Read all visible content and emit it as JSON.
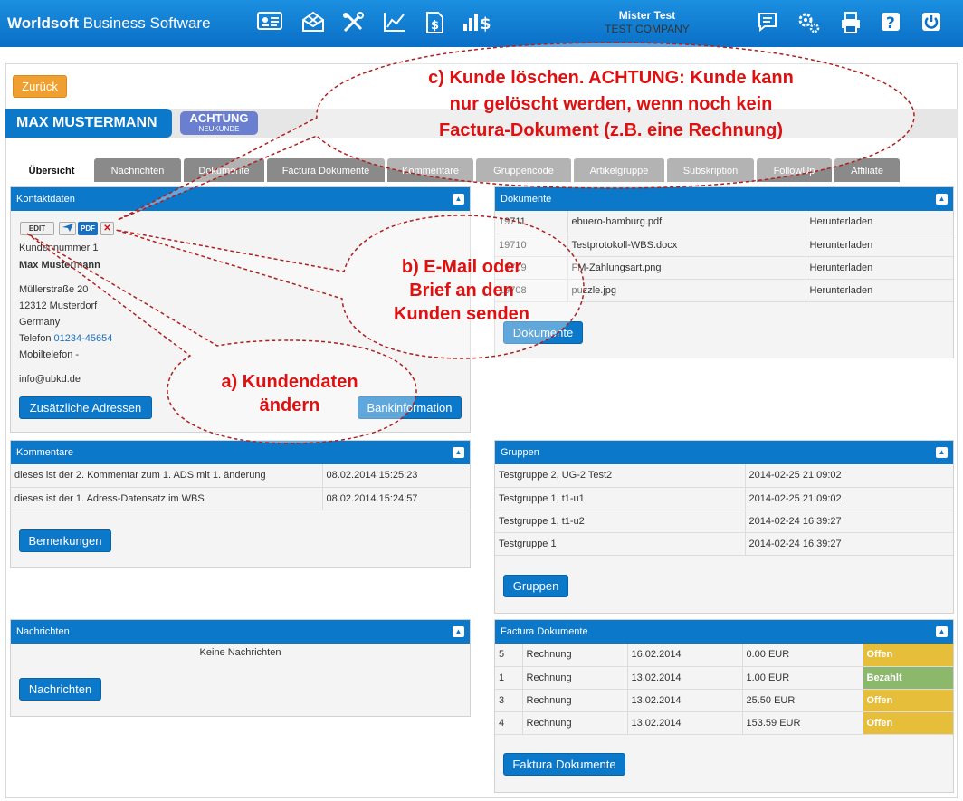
{
  "app": {
    "brand_bold": "Worldsoft",
    "brand_rest": " Business Software"
  },
  "topbar": {
    "icons": [
      "contact-card-icon",
      "mail-icon",
      "tools-icon",
      "chart-icon",
      "invoice-icon",
      "revenue-icon"
    ],
    "user_name": "Mister Test",
    "company": "TEST COMPANY",
    "right_icons": [
      "message-icon",
      "settings-icon",
      "print-icon",
      "help-icon",
      "power-icon"
    ]
  },
  "back_label": "Zurück",
  "customer": {
    "name": "MAX MUSTERMANN",
    "badge_main": "ACHTUNG",
    "badge_sub": "NEUKUNDE"
  },
  "tabs": [
    "Übersicht",
    "Nachrichten",
    "Dokumente",
    "Factura Dokumente",
    "Kommentare",
    "Gruppencode",
    "Artikelgruppe",
    "Subskription",
    "FollowUp",
    "Affiliate"
  ],
  "contact": {
    "title": "Kontaktdaten",
    "edit_label": "EDIT",
    "pdf_label": "PDF",
    "delete_label": "✕",
    "customer_no": "Kundennummer 1",
    "name": "Max Mustermann",
    "street": "Müllerstraße 20",
    "city": "12312 Musterdorf",
    "country": "Germany",
    "phone_label": "Telefon ",
    "phone": "01234-45654",
    "mobile": "Mobiltelefon -",
    "email": "info@ubkd.de",
    "btn_addresses": "Zusätzliche Adressen",
    "btn_bank": "Bankinformation"
  },
  "documents": {
    "title": "Dokumente",
    "rows": [
      {
        "id": "19711",
        "file": "ebuero-hamburg.pdf",
        "action": "Herunterladen"
      },
      {
        "id": "19710",
        "file": "Testprotokoll-WBS.docx",
        "action": "Herunterladen"
      },
      {
        "id": "19709",
        "file": "FM-Zahlungsart.png",
        "action": "Herunterladen"
      },
      {
        "id": "19708",
        "file": "puzzle.jpg",
        "action": "Herunterladen"
      }
    ],
    "button": "Dokumente"
  },
  "comments": {
    "title": "Kommentare",
    "rows": [
      {
        "text": "dieses ist der 2. Kommentar zum 1. ADS mit 1. änderung",
        "date": "08.02.2014 15:25:23"
      },
      {
        "text": "dieses ist der 1. Adress-Datensatz im WBS",
        "date": "08.02.2014 15:24:57"
      }
    ],
    "button": "Bemerkungen"
  },
  "groups": {
    "title": "Gruppen",
    "rows": [
      {
        "name": "Testgruppe 2, UG-2 Test2",
        "date": "2014-02-25 21:09:02"
      },
      {
        "name": "Testgruppe 1, t1-u1",
        "date": "2014-02-25 21:09:02"
      },
      {
        "name": "Testgruppe 1, t1-u2",
        "date": "2014-02-24 16:39:27"
      },
      {
        "name": "Testgruppe 1",
        "date": "2014-02-24 16:39:27"
      }
    ],
    "button": "Gruppen"
  },
  "messages": {
    "title": "Nachrichten",
    "empty": "Keine Nachrichten",
    "button": "Nachrichten"
  },
  "factura": {
    "title": "Factura Dokumente",
    "rows": [
      {
        "no": "5",
        "type": "Rechnung",
        "date": "16.02.2014",
        "amount": "0.00 EUR",
        "status": "Offen",
        "paid": false
      },
      {
        "no": "1",
        "type": "Rechnung",
        "date": "13.02.2014",
        "amount": "1.00 EUR",
        "status": "Bezahlt",
        "paid": true
      },
      {
        "no": "3",
        "type": "Rechnung",
        "date": "13.02.2014",
        "amount": "25.50 EUR",
        "status": "Offen",
        "paid": false
      },
      {
        "no": "4",
        "type": "Rechnung",
        "date": "13.02.2014",
        "amount": "153.59 EUR",
        "status": "Offen",
        "paid": false
      }
    ],
    "button": "Faktura Dokumente"
  },
  "annotations": {
    "c_line1": "c) Kunde löschen. ACHTUNG: Kunde kann",
    "c_line2": "nur gelöscht werden, wenn noch kein",
    "c_line3": "Factura-Dokument (z.B. eine Rechnung)",
    "b_line1": "b) E-Mail oder",
    "b_line2": "Brief an den",
    "b_line3": "Kunden senden",
    "a_line1": "a) Kundendaten",
    "a_line2": "ändern"
  }
}
